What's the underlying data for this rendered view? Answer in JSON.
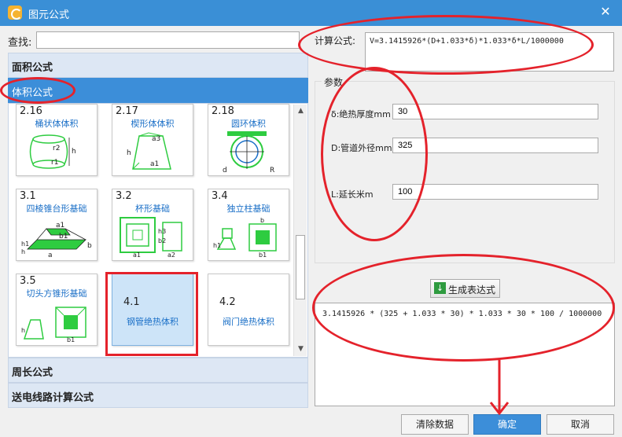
{
  "window": {
    "title": "图元公式",
    "close_glyph": "✕"
  },
  "search": {
    "label": "查找:",
    "value": "",
    "placeholder": ""
  },
  "groups": {
    "area": "面积公式",
    "volume": "体积公式",
    "perimeter": "周长公式",
    "power_line": "送电线路计算公式"
  },
  "cards": [
    {
      "num": "2.16",
      "name": "桶状体体积"
    },
    {
      "num": "2.17",
      "name": "楔形体体积"
    },
    {
      "num": "2.18",
      "name": "圆环体积"
    },
    {
      "num": "3.1",
      "name": "四棱锥台形基础"
    },
    {
      "num": "3.2",
      "name": "杯形基础"
    },
    {
      "num": "3.4",
      "name": "独立柱基础"
    },
    {
      "num": "3.5",
      "name": "切头方锥形基础"
    },
    {
      "num": "4.1",
      "name": "钢管绝热体积"
    },
    {
      "num": "4.2",
      "name": "阀门绝热体积"
    }
  ],
  "formula": {
    "label": "计算公式:",
    "value": "V=3.1415926*(D+1.033*δ)*1.033*δ*L/1000000"
  },
  "params": {
    "legend": "参数",
    "items": [
      {
        "label": "δ:绝热厚度mm",
        "value": "30"
      },
      {
        "label": "D:管道外径mm",
        "value": "325"
      },
      {
        "label": "L:延长米m",
        "value": "100"
      }
    ]
  },
  "generate_button": {
    "label": "生成表达式",
    "icon": "download-arrow-icon"
  },
  "result": {
    "value": "3.1415926 * (325 + 1.033 * 30) * 1.033 * 30 * 100 / 1000000"
  },
  "buttons": {
    "clear": "清除数据",
    "ok": "确定",
    "cancel": "取消"
  },
  "colors": {
    "accent": "#3c8ed9",
    "annotation": "#e4222b",
    "link_text": "#1a6fc7"
  }
}
